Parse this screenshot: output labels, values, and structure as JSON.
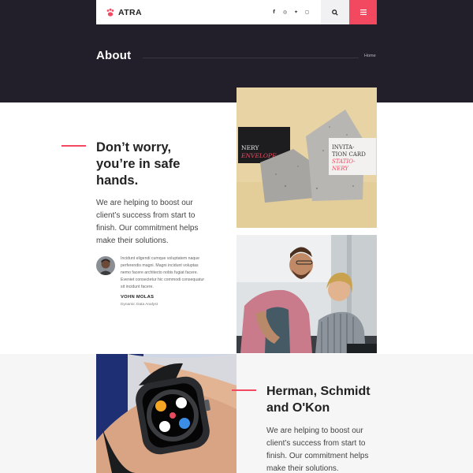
{
  "nav": {
    "logo_text": "ATRA",
    "social_icons": [
      "facebook-icon",
      "instagram-icon",
      "twitter-icon",
      "instagram-icon"
    ],
    "social_glyphs": [
      "f",
      "◎",
      "✦",
      "◻"
    ]
  },
  "page": {
    "title": "About",
    "breadcrumb": "Home"
  },
  "section1": {
    "heading_lines": [
      "Don’t worry,",
      "you’re in safe",
      "hands."
    ],
    "paragraph_lines": [
      "We are helping to boost our",
      "client’s success from start to",
      "finish. Our commitment helps",
      "make their solutions."
    ],
    "quote_lines": [
      "Incidunt eligendi cumque voluptatem naque",
      "perferendis magni. Magni incidunt voluptas",
      "nemo facere architecto nobis fugiat facere.",
      "Eveniet consectetur hic commodi consequatur",
      "sit incidunt facere."
    ],
    "author": "VOHN MOLAS",
    "role": "Dynamic Data Analyst"
  },
  "section2": {
    "heading_lines": [
      "Herman, Schmidt",
      "and O'Kon"
    ],
    "paragraph_lines": [
      "We are helping to boost our",
      "client’s success from start to",
      "finish. Our commitment helps",
      "make their solutions."
    ]
  },
  "stationery": {
    "card_left_lines": [
      "NERY",
      "ENVELOPE"
    ],
    "card_right_lines": [
      "INVITA-",
      "TION CARD",
      "STATIO-",
      "NERY"
    ]
  },
  "colors": {
    "accent": "#f34960",
    "dark": "#221f2b",
    "light_band": "#f6f6f7"
  }
}
